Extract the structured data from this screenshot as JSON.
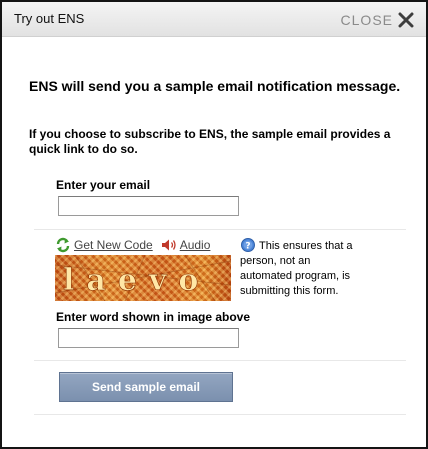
{
  "dialog": {
    "title": "Try out ENS",
    "close_label": "CLOSE"
  },
  "content": {
    "heading": "ENS will send you a sample email notification message.",
    "intro": "If you choose to subscribe to ENS, the sample email provides a quick link to do so."
  },
  "email": {
    "label": "Enter your email",
    "value": "",
    "placeholder": ""
  },
  "captcha": {
    "get_new_code_label": "Get New Code",
    "audio_label": "Audio",
    "image_word": "laevo",
    "info_text": "This ensures that a person, not an automated program, is submitting this form.",
    "word_label": "Enter word shown in image above",
    "word_value": "",
    "word_placeholder": ""
  },
  "submit": {
    "label": "Send sample email"
  },
  "icons": {
    "close": "close-x-icon",
    "refresh": "refresh-arrows-icon",
    "audio": "speaker-icon",
    "info": "help-info-icon"
  },
  "colors": {
    "submit_bg": "#7f93b0",
    "link": "#444444",
    "close_text": "#8a8a8a",
    "captcha_bg": "#d8701f"
  }
}
